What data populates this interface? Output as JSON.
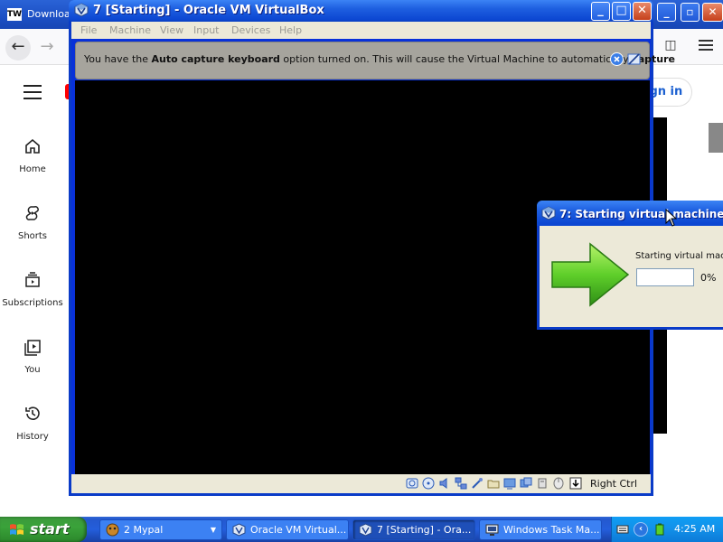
{
  "browser": {
    "tab_title": "Download",
    "logo_text": "TW",
    "sign_in": "ign in",
    "nav": [
      {
        "label": "Home",
        "icon": "home-icon"
      },
      {
        "label": "Shorts",
        "icon": "shorts-icon"
      },
      {
        "label": "Subscriptions",
        "icon": "subscriptions-icon"
      },
      {
        "label": "You",
        "icon": "you-icon"
      },
      {
        "label": "History",
        "icon": "history-icon"
      }
    ]
  },
  "vbox": {
    "title": "7 [Starting] - Oracle VM VirtualBox",
    "menu": [
      "File",
      "Machine",
      "View",
      "Input",
      "Devices",
      "Help"
    ],
    "notice": {
      "part1": "You have the ",
      "bold1": "Auto capture keyboard",
      "part2": " option turned on. This will cause the Virtual Machine to automatically ",
      "bold2": "capture"
    },
    "host_key": "Right Ctrl"
  },
  "dialog": {
    "title": "7: Starting virtual machine",
    "message": "Starting virtual mach",
    "progress_percent": 0,
    "progress_label": "0%"
  },
  "taskbar": {
    "start_label": "start",
    "tasks": [
      {
        "label": "2 Mypal",
        "icon": "mypal-icon"
      },
      {
        "label": "Oracle VM Virtual...",
        "icon": "virtualbox-icon"
      },
      {
        "label": "7 [Starting] - Ora...",
        "icon": "virtualbox-icon"
      },
      {
        "label": "Windows Task Ma...",
        "icon": "task-manager-icon"
      }
    ],
    "clock": "4:25 AM"
  },
  "colors": {
    "xp_title_blue": "#0c47d2",
    "xp_start_green": "#3aa23a",
    "vbox_notice_gray": "#a6a49d",
    "dialog_progress_green": "#2ecc40"
  }
}
